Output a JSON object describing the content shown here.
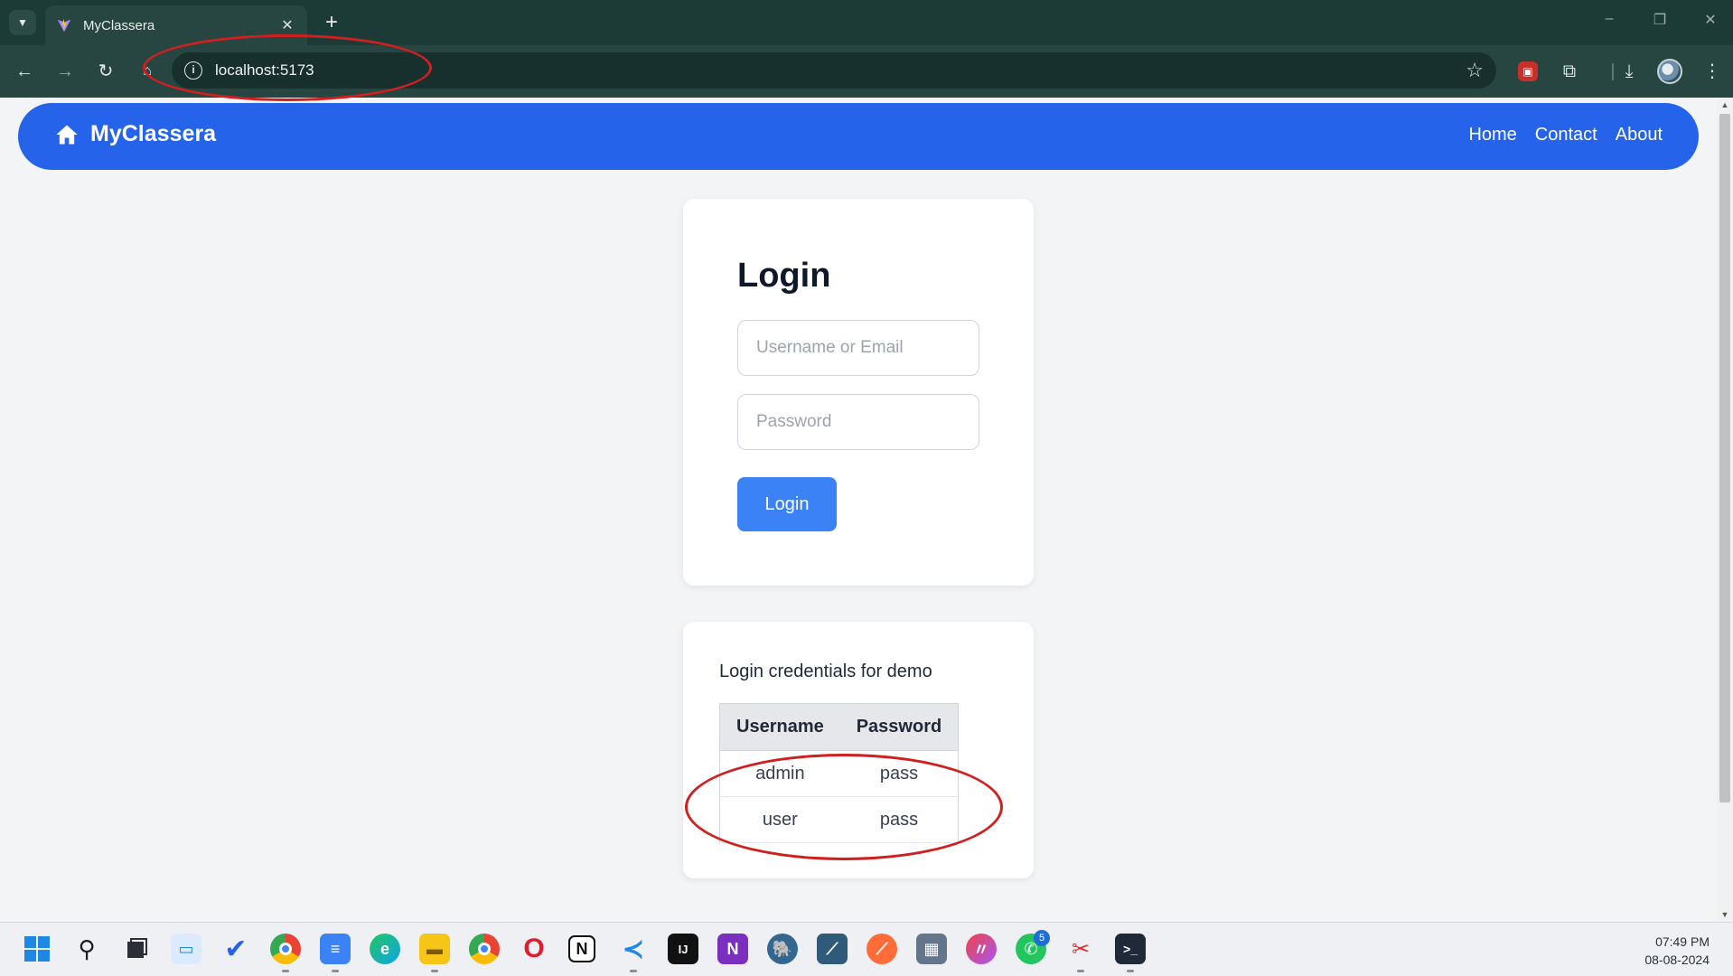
{
  "browser": {
    "tab_title": "MyClassera",
    "tab_close": "✕",
    "new_tab": "+",
    "url": "localhost:5173",
    "window_controls": [
      "–",
      "❐",
      "✕"
    ]
  },
  "navbar": {
    "brand": "MyClassera",
    "links": [
      "Home",
      "Contact",
      "About"
    ],
    "color": "#2563eb"
  },
  "login": {
    "title": "Login",
    "username_placeholder": "Username or Email",
    "password_placeholder": "Password",
    "button_label": "Login",
    "button_color": "#3b82f6"
  },
  "credentials": {
    "heading": "Login credentials for demo",
    "columns": [
      "Username",
      "Password"
    ],
    "rows": [
      [
        "admin",
        "pass"
      ],
      [
        "user",
        "pass"
      ]
    ]
  },
  "annotations": {
    "color": "#d11f1f"
  },
  "taskbar": {
    "icons": [
      "windows-start-icon",
      "search-icon",
      "task-view-icon",
      "widgets-icon",
      "todo-icon",
      "chrome-icon",
      "notepad-icon",
      "edge-icon",
      "file-explorer-icon",
      "chrome-alt-icon",
      "opera-icon",
      "notion-icon",
      "vscode-icon",
      "intellij-icon",
      "onenote-icon",
      "postgresql-icon",
      "mysql-workbench-icon",
      "postman-icon",
      "calculator-icon",
      "arc-icon",
      "whatsapp-icon",
      "snipping-tool-icon",
      "terminal-icon"
    ],
    "whatsapp_badge": "5",
    "time": "07:49 PM",
    "date": "08-08-2024"
  }
}
